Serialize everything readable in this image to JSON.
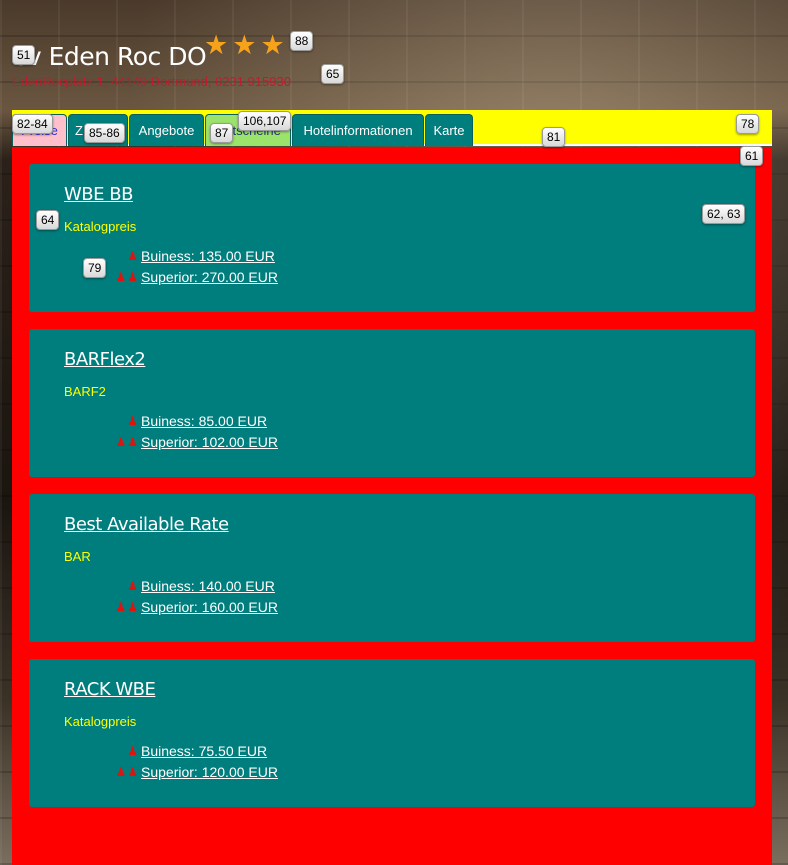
{
  "hotel": {
    "name": "ev Eden Roc DO",
    "address": "EdenRocplatz 1, 44149 Dortmund, 0231 915930",
    "stars": 3
  },
  "tabs": [
    {
      "label": "Preise",
      "state": "active"
    },
    {
      "label": "Z",
      "state": "normal"
    },
    {
      "label": "Angebote",
      "state": "normal"
    },
    {
      "label": "Gutscheine",
      "state": "highlight"
    },
    {
      "label": "Hotelinformationen",
      "state": "normal"
    },
    {
      "label": "Karte",
      "state": "normal"
    }
  ],
  "badges": {
    "b51": "51",
    "b88": "88",
    "b65": "65",
    "b82_84": "82-84",
    "b85_86": "85-86",
    "b87": "87",
    "b106_107": "106,107",
    "b81": "81",
    "b78": "78",
    "b61": "61",
    "b64": "64",
    "b62_63": "62, 63",
    "b79": "79"
  },
  "rates": [
    {
      "title": "WBE BB",
      "code": "Katalogpreis",
      "rooms": [
        {
          "persons": 1,
          "label": "Buiness: 135.00 EUR"
        },
        {
          "persons": 2,
          "label": "Superior: 270.00 EUR"
        }
      ]
    },
    {
      "title": "BARFlex2",
      "code": "BARF2",
      "rooms": [
        {
          "persons": 1,
          "label": "Buiness: 85.00 EUR"
        },
        {
          "persons": 2,
          "label": "Superior: 102.00 EUR"
        }
      ]
    },
    {
      "title": "Best Available Rate",
      "code": "BAR",
      "rooms": [
        {
          "persons": 1,
          "label": "Buiness: 140.00 EUR"
        },
        {
          "persons": 2,
          "label": "Superior: 160.00 EUR"
        }
      ]
    },
    {
      "title": "RACK WBE",
      "code": "Katalogpreis",
      "rooms": [
        {
          "persons": 1,
          "label": "Buiness: 75.50 EUR"
        },
        {
          "persons": 2,
          "label": "Superior: 120.00 EUR"
        }
      ]
    }
  ],
  "colors": {
    "accent_teal": "#007d7d",
    "panel_red": "#ff0000",
    "tabbar_yellow": "#ffff00",
    "star_orange": "#f7a21b",
    "address_red": "#c21a2e",
    "person_icon_red": "#e0140f"
  },
  "icons": {
    "star": "star-icon",
    "person": "person-icon"
  }
}
